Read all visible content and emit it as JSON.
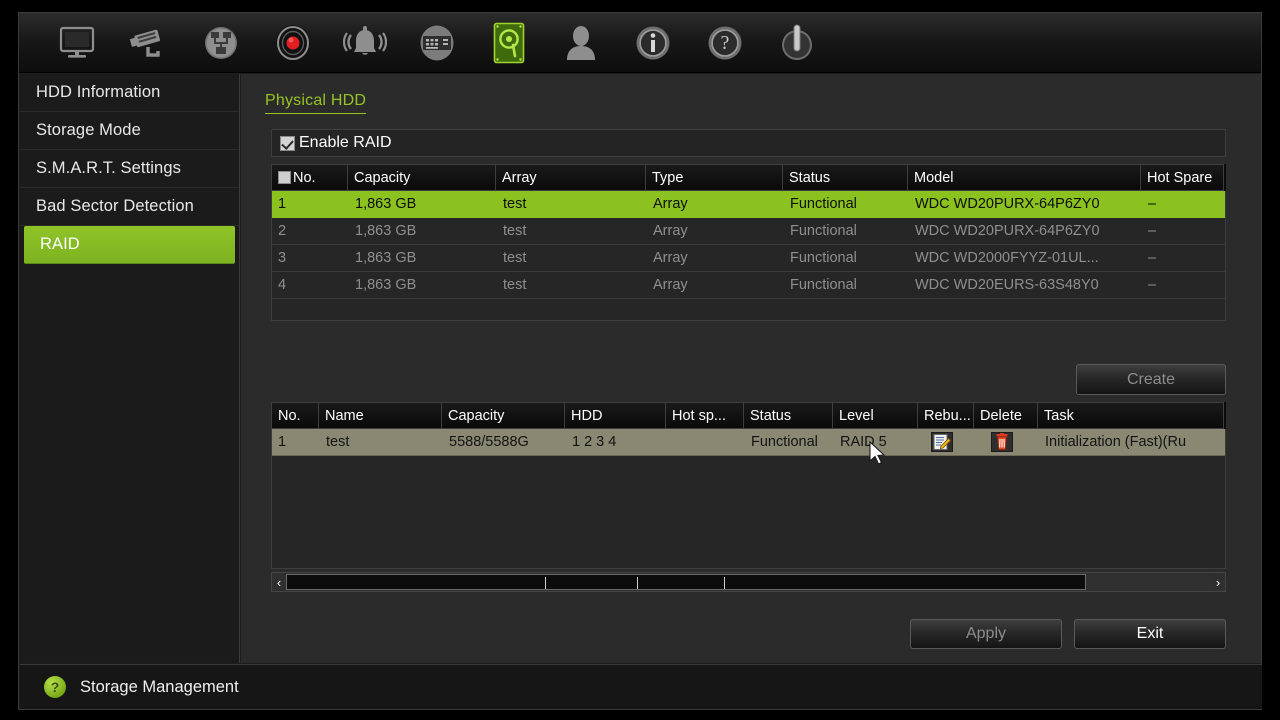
{
  "toolbar": {
    "items": [
      {
        "name": "monitor-icon",
        "label": "Live View"
      },
      {
        "name": "camera-icon",
        "label": "Camera"
      },
      {
        "name": "network-icon",
        "label": "Network"
      },
      {
        "name": "record-icon",
        "label": "Record"
      },
      {
        "name": "alarm-bell-icon",
        "label": "Alarm"
      },
      {
        "name": "device-icon",
        "label": "Device"
      },
      {
        "name": "hdd-icon",
        "label": "HDD",
        "active": true
      },
      {
        "name": "user-icon",
        "label": "User"
      },
      {
        "name": "info-icon",
        "label": "Information"
      },
      {
        "name": "help-icon",
        "label": "Help"
      },
      {
        "name": "power-icon",
        "label": "Shutdown"
      }
    ]
  },
  "sidebar": {
    "items": [
      {
        "label": "HDD Information",
        "active": false
      },
      {
        "label": "Storage Mode",
        "active": false
      },
      {
        "label": "S.M.A.R.T. Settings",
        "active": false
      },
      {
        "label": "Bad Sector Detection",
        "active": false
      },
      {
        "label": "RAID",
        "active": true
      }
    ]
  },
  "main": {
    "panel_title": "Physical HDD",
    "enable_raid": {
      "label": "Enable RAID",
      "checked": true
    },
    "physical_hdd_table": {
      "columns": [
        "No.",
        "Capacity",
        "Array",
        "Type",
        "Status",
        "Model",
        "Hot Spare"
      ],
      "rows": [
        {
          "no": "1",
          "capacity": "1,863 GB",
          "array": "test",
          "type": "Array",
          "status": "Functional",
          "model": "WDC WD20PURX-64P6ZY0",
          "hot_spare": "–",
          "selected": true
        },
        {
          "no": "2",
          "capacity": "1,863 GB",
          "array": "test",
          "type": "Array",
          "status": "Functional",
          "model": "WDC WD20PURX-64P6ZY0",
          "hot_spare": "–",
          "selected": false
        },
        {
          "no": "3",
          "capacity": "1,863 GB",
          "array": "test",
          "type": "Array",
          "status": "Functional",
          "model": "WDC WD2000FYYZ-01UL...",
          "hot_spare": "–",
          "selected": false
        },
        {
          "no": "4",
          "capacity": "1,863 GB",
          "array": "test",
          "type": "Array",
          "status": "Functional",
          "model": "WDC WD20EURS-63S48Y0",
          "hot_spare": "–",
          "selected": false
        }
      ]
    },
    "create_button": "Create",
    "array_table": {
      "columns": [
        "No.",
        "Name",
        "Capacity",
        "HDD",
        "Hot sp...",
        "Status",
        "Level",
        "Rebu...",
        "Delete",
        "Task"
      ],
      "rows": [
        {
          "no": "1",
          "name": "test",
          "capacity": "5588/5588G",
          "hdd": "1  2  3  4",
          "hot_spare": "",
          "status": "Functional",
          "level": "RAID 5",
          "rebuild_icon": "edit-pencil-icon",
          "delete_icon": "trash-icon",
          "task": "Initialization (Fast)(Ru",
          "selected": true
        }
      ]
    },
    "scrollbar": {
      "left_arrow": "‹",
      "right_arrow": "›"
    },
    "apply_button": "Apply",
    "exit_button": "Exit"
  },
  "statusbar": {
    "help_glyph": "?",
    "text": "Storage Management"
  },
  "colors": {
    "accent_green": "#8bc220",
    "title_green": "#97c424",
    "row_selected_tan": "#8a8872",
    "panel_bg": "#2b2b2b"
  }
}
